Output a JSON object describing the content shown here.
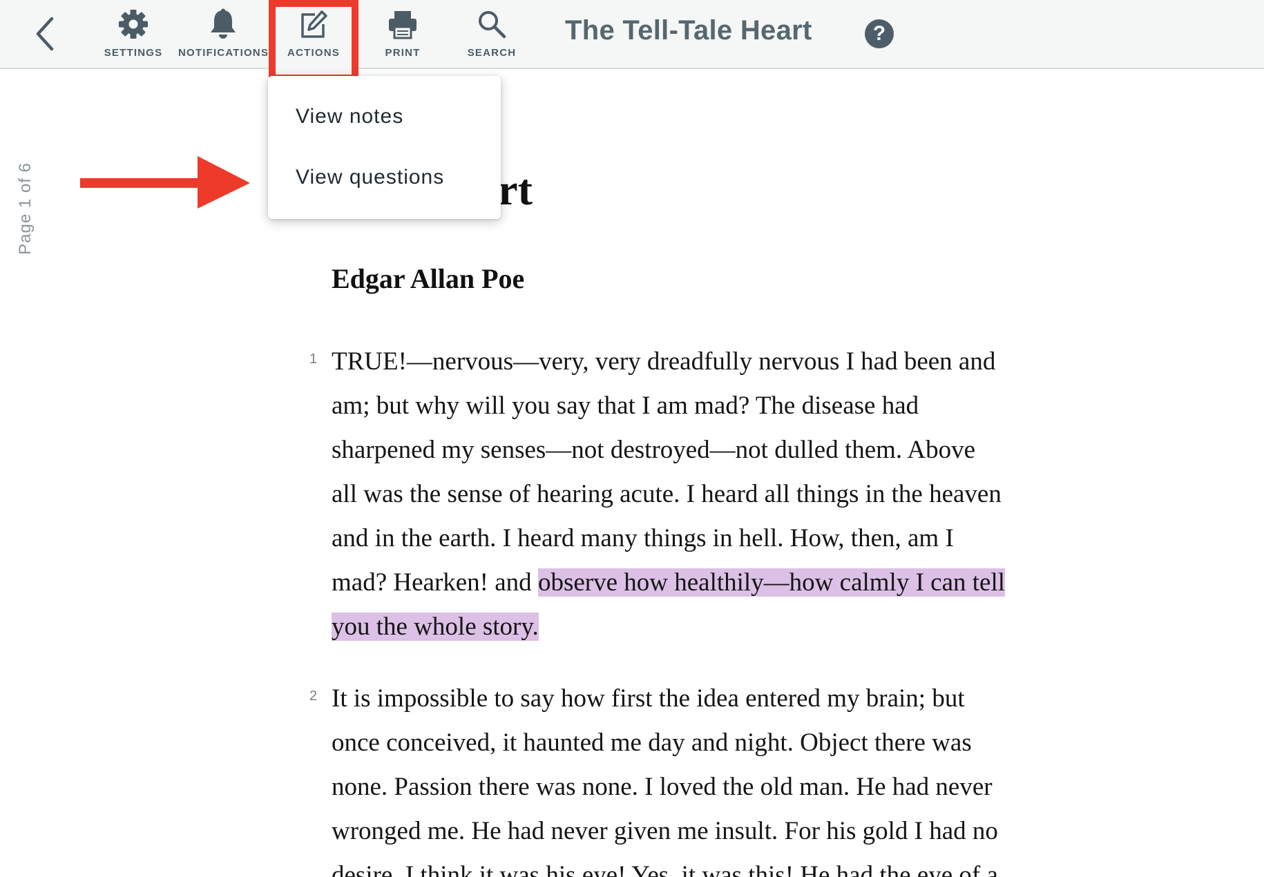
{
  "toolbar": {
    "back_icon": "chevron-left-icon",
    "tools": [
      {
        "label": "SETTINGS",
        "icon": "gear-icon"
      },
      {
        "label": "NOTIFICATIONS",
        "icon": "bell-icon"
      },
      {
        "label": "ACTIONS",
        "icon": "edit-icon",
        "active": true
      },
      {
        "label": "PRINT",
        "icon": "printer-icon"
      },
      {
        "label": "SEARCH",
        "icon": "search-icon"
      }
    ],
    "title": "The Tell-Tale Heart",
    "help_label": "?"
  },
  "actions_menu": {
    "items": [
      "View notes",
      "View questions"
    ]
  },
  "page_indicator": "Page 1 of 6",
  "content": {
    "title_visible": "Tale Heart",
    "author": "Edgar Allan Poe",
    "paragraphs": [
      {
        "number": "1",
        "lines": [
          "TRUE!—nervous—very, very dreadfully nervous I had been and",
          "am; but why will you say that I am mad? The disease had",
          "sharpened my senses—not destroyed—not dulled them. Above",
          "all was the sense of hearing acute. I heard all things in the heaven",
          "and in the earth. I heard many things in hell. How, then, am I"
        ],
        "line6_plain": "mad? Hearken! and ",
        "line6_highlight": "observe how healthily—how calmly I can tell",
        "line7_highlight": "you the whole story."
      },
      {
        "number": "2",
        "lines": [
          "It is impossible to say how first the idea entered my brain; but",
          "once conceived, it haunted me day and night. Object there was",
          "none. Passion there was none. I loved the old man. He had never",
          "wronged me. He had never given me insult. For his gold I had no",
          "desire. I think it was his eye! Yes, it was this! He had the eye of a"
        ]
      }
    ]
  },
  "colors": {
    "toolbar_bg": "#f5f6f6",
    "icon_gray": "#4b5c67",
    "active_outline": "#ee3a2a",
    "annotation_arrow": "#ee3a2a",
    "highlight": "#dcc0e6"
  }
}
